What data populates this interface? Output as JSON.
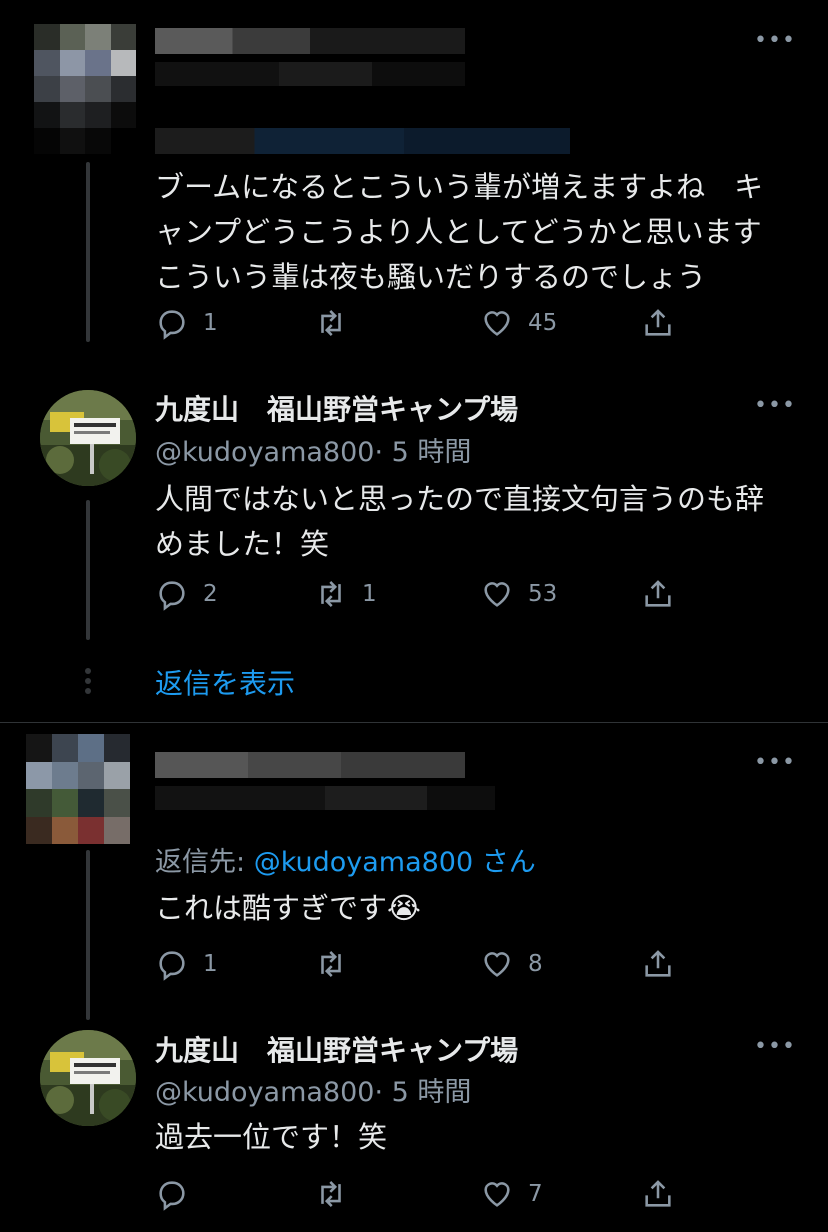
{
  "tweets": [
    {
      "body": "ブームになるとこういう輩が増えますよね　キャンプどうこうより人としてどうかと思いますこういう輩は夜も騒いだりするのでしょう",
      "reply_count": "1",
      "retweet_count": "",
      "like_count": "45"
    },
    {
      "name": "九度山　福山野営キャンプ場",
      "handle": "@kudoyama800",
      "time": "· 5 時間",
      "body": "人間ではないと思ったので直接文句言うのも辞めました！笑",
      "reply_count": "2",
      "retweet_count": "1",
      "like_count": "53"
    },
    {
      "reply_prefix": "返信先: ",
      "reply_to": "@kudoyama800",
      "reply_suffix": " さん",
      "body": "これは酷すぎです😭",
      "reply_count": "1",
      "retweet_count": "",
      "like_count": "8"
    },
    {
      "name": "九度山　福山野営キャンプ場",
      "handle": "@kudoyama800",
      "time": "· 5 時間",
      "body": "過去一位です！笑",
      "reply_count": "",
      "retweet_count": "",
      "like_count": "7"
    }
  ],
  "show_replies": "返信を表示",
  "colors": {
    "background": "#000000",
    "text": "#e7e9ea",
    "secondary": "#8b98a5",
    "accent": "#1d9bf0"
  },
  "icons": [
    "more-icon",
    "reply-icon",
    "retweet-icon",
    "like-icon",
    "share-icon"
  ]
}
